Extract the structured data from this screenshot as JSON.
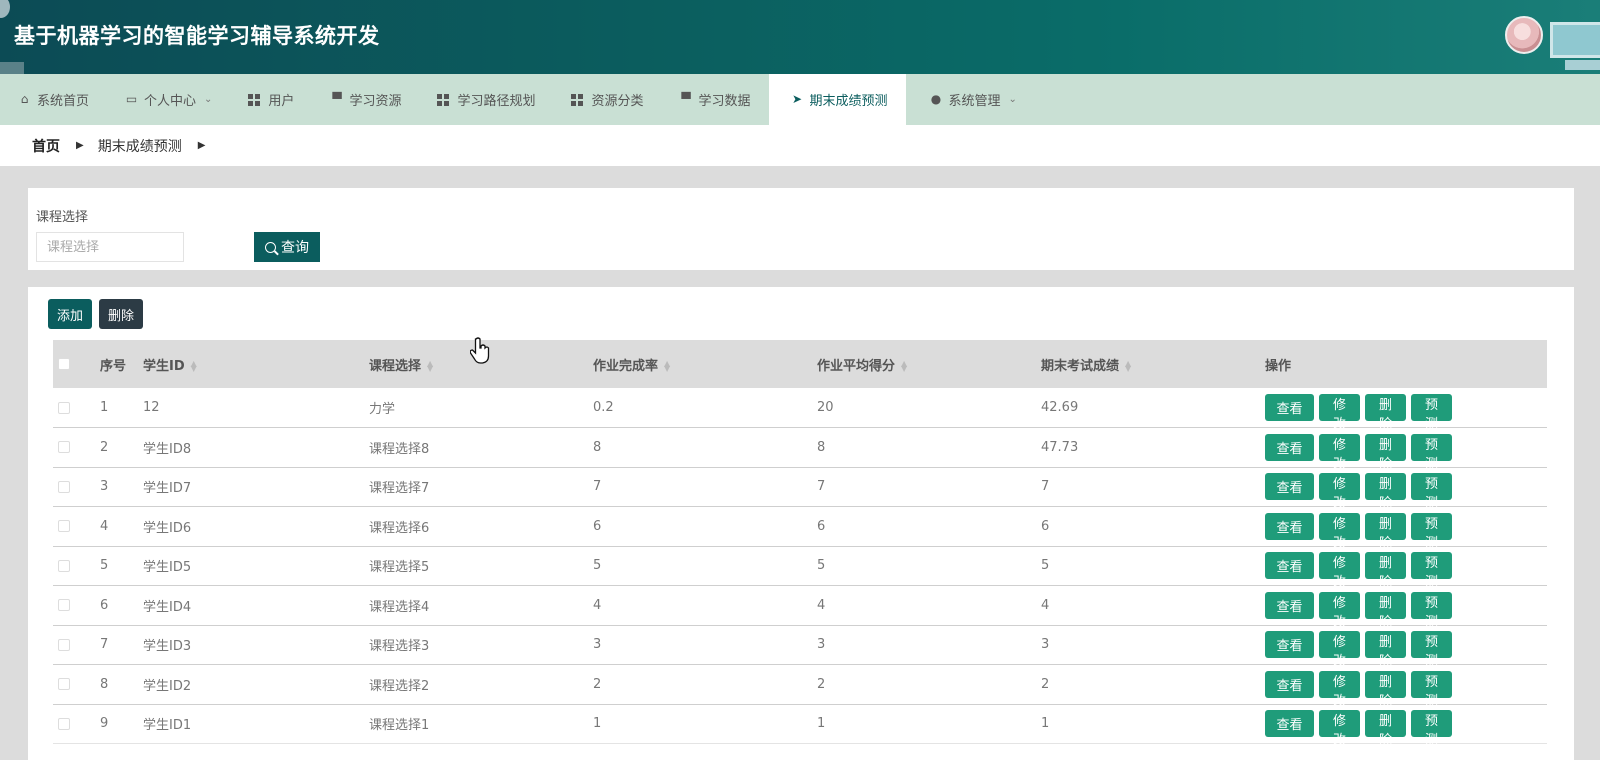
{
  "header": {
    "title": "基于机器学习的智能学习辅导系统开发"
  },
  "nav": {
    "items": [
      {
        "label": "系统首页",
        "icon": "home-icon"
      },
      {
        "label": "个人中心",
        "icon": "calendar-icon",
        "dropdown": true
      },
      {
        "label": "用户",
        "icon": "grid-icon"
      },
      {
        "label": "学习资源",
        "icon": "stamp-icon"
      },
      {
        "label": "学习路径规划",
        "icon": "grid-icon"
      },
      {
        "label": "资源分类",
        "icon": "grid-icon"
      },
      {
        "label": "学习数据",
        "icon": "stamp-icon"
      },
      {
        "label": "期末成绩预测",
        "icon": "paper-plane-icon",
        "active": true
      },
      {
        "label": "系统管理",
        "icon": "user-icon",
        "dropdown": true
      }
    ]
  },
  "breadcrumb": {
    "home": "首页",
    "current": "期末成绩预测"
  },
  "search": {
    "label": "课程选择",
    "placeholder": "课程选择",
    "button": "查询"
  },
  "toolbar": {
    "add": "添加",
    "delete": "删除"
  },
  "table": {
    "headers": {
      "index": "序号",
      "student_id": "学生ID",
      "course": "课程选择",
      "rate": "作业完成率",
      "avg": "作业平均得分",
      "final": "期末考试成绩",
      "ops": "操作"
    },
    "op_labels": {
      "view": "查看",
      "edit": "修改",
      "remove": "删除",
      "predict": "预测"
    },
    "rows": [
      {
        "index": "1",
        "student_id": "12",
        "course": "力学",
        "rate": "0.2",
        "avg": "20",
        "final": "42.69"
      },
      {
        "index": "2",
        "student_id": "学生ID8",
        "course": "课程选择8",
        "rate": "8",
        "avg": "8",
        "final": "47.73"
      },
      {
        "index": "3",
        "student_id": "学生ID7",
        "course": "课程选择7",
        "rate": "7",
        "avg": "7",
        "final": "7"
      },
      {
        "index": "4",
        "student_id": "学生ID6",
        "course": "课程选择6",
        "rate": "6",
        "avg": "6",
        "final": "6"
      },
      {
        "index": "5",
        "student_id": "学生ID5",
        "course": "课程选择5",
        "rate": "5",
        "avg": "5",
        "final": "5"
      },
      {
        "index": "6",
        "student_id": "学生ID4",
        "course": "课程选择4",
        "rate": "4",
        "avg": "4",
        "final": "4"
      },
      {
        "index": "7",
        "student_id": "学生ID3",
        "course": "课程选择3",
        "rate": "3",
        "avg": "3",
        "final": "3"
      },
      {
        "index": "8",
        "student_id": "学生ID2",
        "course": "课程选择2",
        "rate": "2",
        "avg": "2",
        "final": "2"
      },
      {
        "index": "9",
        "student_id": "学生ID1",
        "course": "课程选择1",
        "rate": "1",
        "avg": "1",
        "final": "1"
      }
    ]
  }
}
